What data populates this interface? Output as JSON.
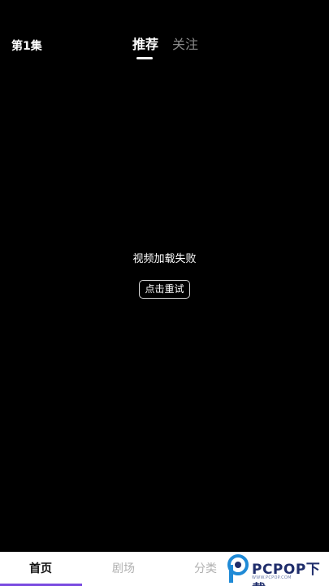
{
  "header": {
    "episode_label": "第1集",
    "tabs": [
      {
        "label": "推荐",
        "active": true
      },
      {
        "label": "关注",
        "active": false
      }
    ]
  },
  "player": {
    "error_message": "视频加载失败",
    "retry_label": "点击重试"
  },
  "bottom_nav": {
    "items": [
      {
        "label": "首页",
        "active": true
      },
      {
        "label": "剧场",
        "active": false
      },
      {
        "label": "分类",
        "active": false
      }
    ],
    "accent_color": "#7a4be0"
  },
  "watermark": {
    "text": "PCPOP下载",
    "sub": "WWW.PCPOP.COM"
  }
}
